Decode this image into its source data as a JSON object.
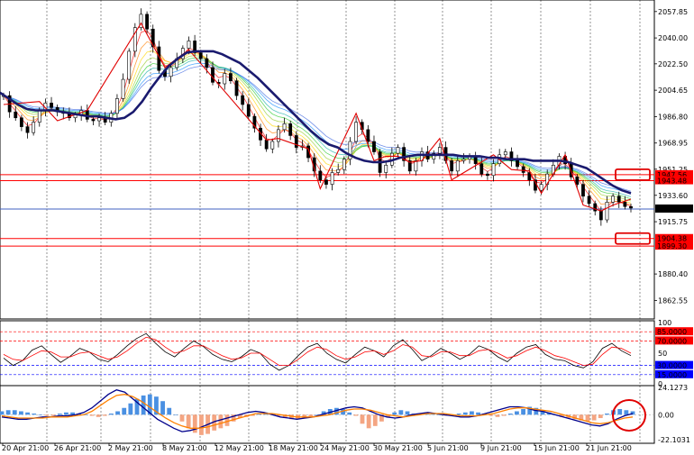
{
  "chart_data": [
    {
      "type": "line",
      "panel": "price",
      "ylim": [
        1850.0,
        2062.0
      ],
      "y_ticks": [
        "2057.85",
        "2040.00",
        "2022.50",
        "2004.65",
        "1986.80",
        "1968.95",
        "1951.25",
        "1933.60",
        "1915.75",
        "1880.40",
        "1862.55"
      ],
      "x_ticks": [
        "20 Apr 21:00",
        "26 Apr 21:00",
        "2 May 21:00",
        "8 May 21:00",
        "12 May 21:00",
        "18 May 21:00",
        "24 May 21:00",
        "30 May 21:00",
        "5 Jun 21:00",
        "9 Jun 21:00",
        "15 Jun 21:00",
        "21 Jun 21:00"
      ],
      "series": [
        {
          "role": "price_close",
          "color": "#000000",
          "values": [
            2001,
            1990,
            1986,
            1980,
            1976,
            1983,
            1991,
            1996,
            1993,
            1990,
            1989,
            1986,
            1988,
            1991,
            1985,
            1984,
            1986,
            1983,
            1989,
            1999,
            2012,
            2031,
            2047,
            2056,
            2046,
            2034,
            2018,
            2014,
            2020,
            2026,
            2033,
            2038,
            2030,
            2026,
            2020,
            2010,
            2009,
            2016,
            2011,
            2001,
            1995,
            1987,
            1979,
            1971,
            1965,
            1970,
            1978,
            1982,
            1974,
            1966,
            1967,
            1959,
            1950,
            1944,
            1941,
            1949,
            1951,
            1958,
            1970,
            1983,
            1978,
            1970,
            1963,
            1949,
            1954,
            1962,
            1966,
            1957,
            1950,
            1957,
            1963,
            1958,
            1962,
            1966,
            1957,
            1950,
            1957,
            1958,
            1960,
            1955,
            1948,
            1947,
            1955,
            1961,
            1963,
            1957,
            1953,
            1949,
            1944,
            1937,
            1941,
            1948,
            1954,
            1960,
            1955,
            1946,
            1941,
            1933,
            1928,
            1923,
            1917,
            1929,
            1933,
            1929,
            1926,
            1925
          ]
        },
        {
          "role": "moving_average",
          "color": "#1a1a6e",
          "values": [
            2003,
            1999,
            1995,
            1992,
            1991,
            1991,
            1991,
            1990,
            1989,
            1988,
            1987,
            1987,
            1986,
            1985,
            1986,
            1990,
            1997,
            2006,
            2014,
            2021,
            2026,
            2030,
            2031,
            2031,
            2031,
            2029,
            2026,
            2023,
            2018,
            2013,
            2007,
            2001,
            1995,
            1989,
            1983,
            1977,
            1972,
            1968,
            1966,
            1962,
            1959,
            1957,
            1956,
            1956,
            1957,
            1959,
            1960,
            1961,
            1961,
            1961,
            1961,
            1961,
            1960,
            1960,
            1960,
            1959,
            1959,
            1958,
            1958,
            1958,
            1957,
            1957,
            1957,
            1957,
            1956,
            1954,
            1952,
            1948,
            1944,
            1940,
            1937,
            1935
          ]
        }
      ],
      "levels": [
        {
          "value": "1947.56",
          "color": "#ff0000"
        },
        {
          "value": "1943.48",
          "color": "#ff0000"
        },
        {
          "value": "1924.34",
          "color": "#4060c0"
        },
        {
          "value": "1904.38",
          "color": "#ff0000"
        },
        {
          "value": "1899.30",
          "color": "#ff0000"
        }
      ],
      "current_price": "1924.34"
    },
    {
      "type": "line",
      "panel": "oscillator",
      "ylim": [
        0,
        100
      ],
      "y_ticks": [
        "100",
        "85.0000",
        "70.0000",
        "50",
        "30.0000",
        "15.0000",
        "0"
      ],
      "levels": [
        "85.0000",
        "70.0000",
        "30.0000",
        "15.0000"
      ],
      "series": [
        {
          "role": "fast",
          "color": "#000000",
          "values": [
            42,
            30,
            38,
            55,
            62,
            48,
            35,
            45,
            58,
            52,
            40,
            36,
            48,
            62,
            74,
            82,
            66,
            52,
            44,
            58,
            70,
            61,
            48,
            40,
            36,
            44,
            56,
            50,
            32,
            22,
            30,
            46,
            60,
            66,
            50,
            40,
            34,
            48,
            60,
            54,
            44,
            62,
            72,
            56,
            38,
            46,
            58,
            50,
            40,
            48,
            62,
            56,
            44,
            36,
            50,
            60,
            64,
            48,
            40,
            38,
            30,
            26,
            36,
            58,
            66,
            54,
            46
          ]
        },
        {
          "role": "slow",
          "color": "#ff0000",
          "values": [
            48,
            40,
            38,
            46,
            54,
            52,
            44,
            44,
            50,
            52,
            46,
            40,
            44,
            54,
            66,
            76,
            72,
            60,
            50,
            54,
            62,
            62,
            54,
            46,
            40,
            42,
            50,
            50,
            40,
            30,
            30,
            40,
            52,
            60,
            56,
            46,
            40,
            44,
            52,
            54,
            48,
            54,
            64,
            60,
            46,
            44,
            52,
            52,
            46,
            46,
            54,
            56,
            50,
            42,
            46,
            54,
            60,
            54,
            46,
            42,
            36,
            30,
            32,
            48,
            60,
            58,
            50
          ]
        }
      ]
    },
    {
      "type": "bar",
      "panel": "macd",
      "ylim": [
        -22.1031,
        24.1273
      ],
      "y_ticks": [
        "24.1273",
        "0.00",
        "-22.1031"
      ],
      "histogram": [
        3,
        4,
        4,
        3,
        2,
        1,
        0,
        -1,
        -1,
        1,
        2,
        2,
        1,
        0,
        -1,
        -2,
        -1,
        1,
        3,
        6,
        10,
        14,
        17,
        18,
        16,
        12,
        6,
        0,
        -6,
        -12,
        -16,
        -18,
        -17,
        -14,
        -12,
        -10,
        -6,
        -3,
        -2,
        -1,
        1,
        2,
        1,
        -1,
        -3,
        -4,
        -4,
        -3,
        -2,
        0,
        3,
        5,
        6,
        5,
        2,
        -1,
        -8,
        -12,
        -10,
        -6,
        -2,
        2,
        4,
        3,
        1,
        1,
        2,
        1,
        0,
        -1,
        0,
        1,
        2,
        3,
        2,
        1,
        -1,
        -2,
        -1,
        1,
        3,
        5,
        7,
        6,
        4,
        2,
        0,
        -2,
        -3,
        -4,
        -5,
        -6,
        -5,
        -3,
        1,
        4,
        5,
        4,
        3
      ],
      "series": [
        {
          "role": "macd",
          "color": "#00008b",
          "values": [
            -2,
            -3,
            -4,
            -4,
            -3,
            -2,
            -2,
            -1,
            -1,
            0,
            2,
            6,
            12,
            18,
            22,
            20,
            14,
            8,
            2,
            -4,
            -8,
            -12,
            -15,
            -14,
            -12,
            -9,
            -6,
            -4,
            -2,
            0,
            2,
            3,
            2,
            0,
            -2,
            -3,
            -4,
            -3,
            -2,
            0,
            2,
            4,
            6,
            7,
            6,
            3,
            0,
            -2,
            -3,
            -2,
            0,
            1,
            2,
            1,
            0,
            -1,
            -2,
            -2,
            -1,
            1,
            3,
            5,
            7,
            7,
            6,
            4,
            3,
            1,
            -1,
            -3,
            -5,
            -7,
            -9,
            -10,
            -8,
            -4,
            -1,
            1
          ]
        },
        {
          "role": "signal",
          "color": "#ff8000",
          "values": [
            -1,
            -2,
            -3,
            -3,
            -3,
            -3,
            -2,
            -2,
            -2,
            -1,
            0,
            3,
            8,
            13,
            17,
            18,
            16,
            12,
            7,
            2,
            -3,
            -7,
            -10,
            -12,
            -12,
            -11,
            -9,
            -7,
            -5,
            -3,
            -1,
            1,
            1,
            1,
            0,
            -1,
            -2,
            -2,
            -2,
            -1,
            0,
            2,
            4,
            5,
            5,
            4,
            2,
            0,
            -1,
            -2,
            -1,
            0,
            1,
            1,
            1,
            0,
            -1,
            -1,
            -1,
            0,
            1,
            3,
            5,
            6,
            6,
            5,
            4,
            3,
            1,
            -1,
            -3,
            -5,
            -7,
            -8,
            -7,
            -5,
            -3,
            -2
          ]
        }
      ]
    }
  ],
  "annotations": {
    "highlight_color": "#e00000",
    "price_highlight_levels": [
      "1947.56",
      "1904.38"
    ],
    "macd_highlight": "circle"
  },
  "colors": {
    "grid": "#000000",
    "background": "#ffffff",
    "ribbon": [
      "#ff0000",
      "#ff7f00",
      "#ffd700",
      "#9acd32",
      "#32cd32",
      "#20b2aa",
      "#1e90ff",
      "#4169e1"
    ]
  }
}
